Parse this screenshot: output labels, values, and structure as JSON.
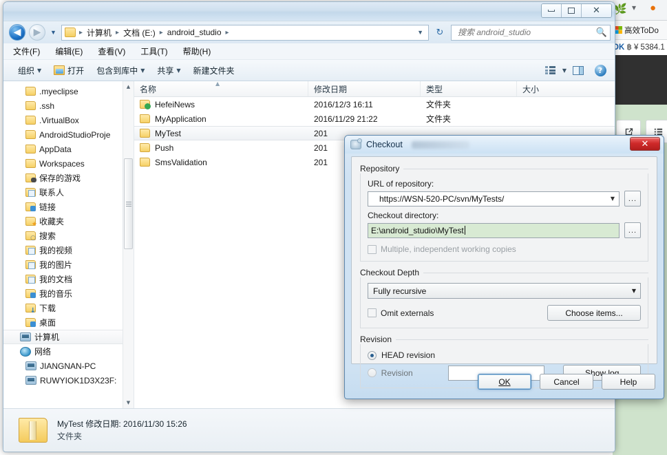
{
  "background": {
    "bookmark_label": "高效ToDo",
    "ticker_prefix": "OK",
    "ticker_text": "฿ ¥ 5384.1",
    "open_external_icon": "open-external-icon",
    "list_icon": "list-icon"
  },
  "explorer": {
    "window_controls": {
      "minimize": "minimize-button",
      "maximize": "maximize-button",
      "close": "✕"
    },
    "address": {
      "back": "◀",
      "forward": "▶",
      "recent_caret": "▼",
      "crumbs": [
        "计算机",
        "文档 (E:)",
        "android_studio"
      ],
      "separator": "▸",
      "dropdown_caret": "▼",
      "refresh": "↻"
    },
    "search": {
      "placeholder": "搜索 android_studio",
      "value": "",
      "icon": "🔍"
    },
    "menubar": [
      "文件(F)",
      "编辑(E)",
      "查看(V)",
      "工具(T)",
      "帮助(H)"
    ],
    "toolbar": {
      "organize": "组织",
      "open": "打开",
      "include_library": "包含到库中",
      "share": "共享",
      "new_folder": "新建文件夹",
      "caret": "▼",
      "help": "?"
    },
    "navpane": {
      "items": [
        {
          "label": ".myeclipse",
          "icon": "folder-icon",
          "kind": "folder",
          "indent": 3
        },
        {
          "label": ".ssh",
          "icon": "folder-icon",
          "kind": "folder",
          "indent": 3
        },
        {
          "label": ".VirtualBox",
          "icon": "folder-icon",
          "kind": "folder",
          "indent": 3
        },
        {
          "label": "AndroidStudioProje",
          "icon": "folder-icon",
          "kind": "folder",
          "indent": 3
        },
        {
          "label": "AppData",
          "icon": "folder-icon",
          "kind": "folder",
          "indent": 3
        },
        {
          "label": "Workspaces",
          "icon": "folder-icon",
          "kind": "folder",
          "indent": 3
        },
        {
          "label": "保存的游戏",
          "icon": "saved-games-icon",
          "kind": "game",
          "indent": 3
        },
        {
          "label": "联系人",
          "icon": "contacts-icon",
          "kind": "doc",
          "indent": 3
        },
        {
          "label": "链接",
          "icon": "links-icon",
          "kind": "blue",
          "indent": 3
        },
        {
          "label": "收藏夹",
          "icon": "favorites-icon",
          "kind": "star",
          "indent": 3
        },
        {
          "label": "搜索",
          "icon": "searches-icon",
          "kind": "search",
          "indent": 3
        },
        {
          "label": "我的视频",
          "icon": "my-videos-icon",
          "kind": "doc",
          "indent": 3
        },
        {
          "label": "我的图片",
          "icon": "my-pictures-icon",
          "kind": "doc",
          "indent": 3
        },
        {
          "label": "我的文档",
          "icon": "my-documents-icon",
          "kind": "doc",
          "indent": 3
        },
        {
          "label": "我的音乐",
          "icon": "my-music-icon",
          "kind": "blue",
          "indent": 3
        },
        {
          "label": "下载",
          "icon": "downloads-icon",
          "kind": "down",
          "indent": 3
        },
        {
          "label": "桌面",
          "icon": "desktop-icon",
          "kind": "blue",
          "indent": 3
        },
        {
          "label": "计算机",
          "icon": "computer-icon",
          "kind": "pc",
          "indent": 2,
          "selected": true
        },
        {
          "label": "网络",
          "icon": "network-icon",
          "kind": "net",
          "indent": 2
        },
        {
          "label": "JIANGNAN-PC",
          "icon": "computer-icon",
          "kind": "pc",
          "indent": 3
        },
        {
          "label": "RUWYIOK1D3X23F:",
          "icon": "computer-icon",
          "kind": "pc",
          "indent": 3
        }
      ],
      "scroll_up": "▲",
      "scroll_down": "▼"
    },
    "filelist": {
      "columns": [
        "名称",
        "修改日期",
        "类型",
        "大小"
      ],
      "sort_indicator": "▲",
      "rows": [
        {
          "name": "HefeiNews",
          "date": "2016/12/3 16:11",
          "type": "文件夹",
          "size": "",
          "icon": "folder-green-check-icon"
        },
        {
          "name": "MyApplication",
          "date": "2016/11/29 21:22",
          "type": "文件夹",
          "size": "",
          "icon": "folder-icon"
        },
        {
          "name": "MyTest",
          "date": "201",
          "type": "",
          "size": "",
          "icon": "folder-icon",
          "selected": true
        },
        {
          "name": "Push",
          "date": "201",
          "type": "",
          "size": "",
          "icon": "folder-icon"
        },
        {
          "name": "SmsValidation",
          "date": "201",
          "type": "",
          "size": "",
          "icon": "folder-icon"
        }
      ]
    },
    "statusbar": {
      "name": "MyTest",
      "date_label": "修改日期:",
      "date_value": "2016/11/30 15:26",
      "type": "文件夹"
    }
  },
  "dialog": {
    "title": "Checkout",
    "close": "✕",
    "repository": {
      "legend": "Repository",
      "url_label": "URL of repository:",
      "url_value": "https://WSN-520-PC/svn/MyTests/",
      "dir_label": "Checkout directory:",
      "dir_value": "E:\\android_studio\\MyTest",
      "multiple_label": "Multiple, independent working copies",
      "browse": "...",
      "caret": "▼"
    },
    "depth": {
      "legend": "Checkout Depth",
      "value": "Fully recursive",
      "omit_externals_label": "Omit externals",
      "choose_items_label": "Choose items...",
      "caret": "▼"
    },
    "revision": {
      "legend": "Revision",
      "head_label": "HEAD revision",
      "revision_label": "Revision",
      "revision_value": "",
      "show_log_label": "Show log"
    },
    "footer": {
      "ok": "OK",
      "cancel": "Cancel",
      "help": "Help"
    }
  }
}
